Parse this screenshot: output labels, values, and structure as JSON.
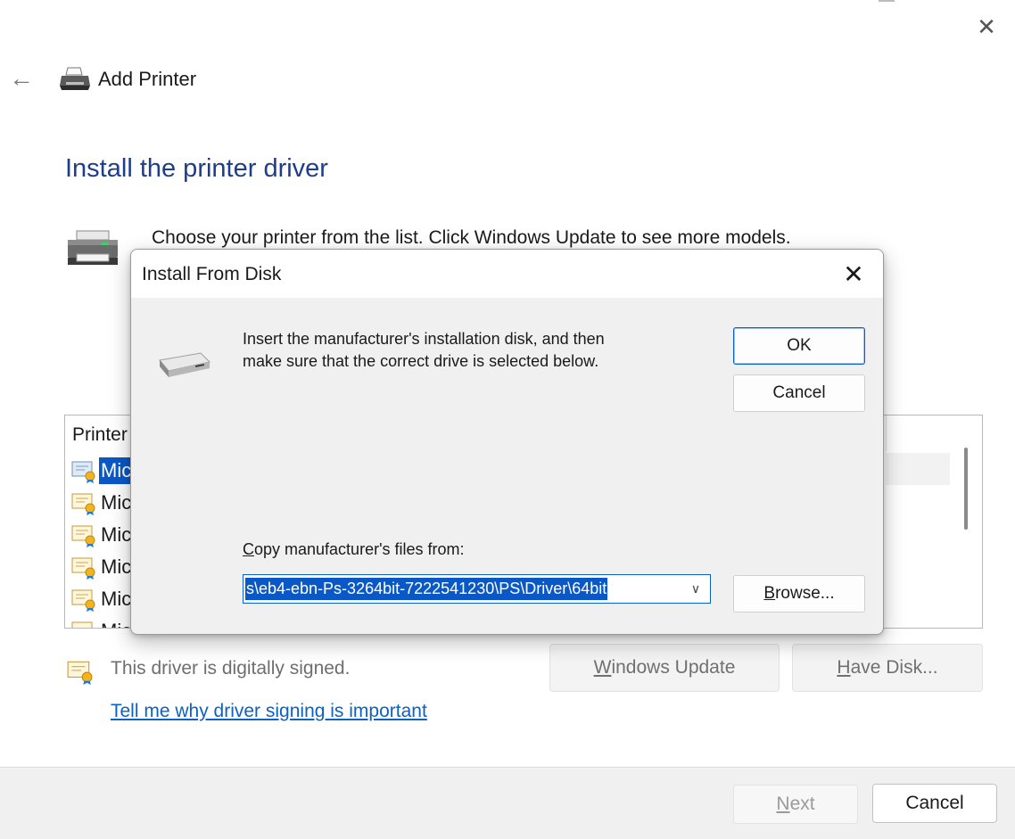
{
  "wizard": {
    "title": "Add Printer",
    "heading": "Install the printer driver",
    "instructions": "Choose your printer from the list. Click Windows Update to see more models.",
    "list_header": "Printer",
    "list_items": [
      {
        "label": "Mic",
        "selected": true
      },
      {
        "label": "Mic",
        "selected": false
      },
      {
        "label": "Mic",
        "selected": false
      },
      {
        "label": "Mic",
        "selected": false
      },
      {
        "label": "Mic",
        "selected": false
      },
      {
        "label": "Mic",
        "selected": false
      }
    ],
    "signed_text": "This driver is digitally signed.",
    "signing_link": "Tell me why driver signing is important",
    "windows_update": {
      "pre": "",
      "accel": "W",
      "post": "indows Update"
    },
    "have_disk": {
      "pre": "",
      "accel": "H",
      "post": "ave Disk..."
    },
    "next": {
      "pre": "",
      "accel": "N",
      "post": "ext"
    },
    "cancel": "Cancel"
  },
  "dialog": {
    "title": "Install From Disk",
    "message_line1": "Insert the manufacturer's installation disk, and then",
    "message_line2": "make sure that the correct drive is selected below.",
    "ok": "OK",
    "cancel": "Cancel",
    "copy_label": {
      "pre": "",
      "accel": "C",
      "post": "opy manufacturer's files from:"
    },
    "copy_value": "s\\eb4-ebn-Ps-3264bit-7222541230\\PS\\Driver\\64bit",
    "browse": {
      "pre": "",
      "accel": "B",
      "post": "rowse..."
    }
  },
  "icons": {
    "close": "close-icon",
    "back": "back-arrow-icon",
    "printer": "printer-icon",
    "disk": "disk-drive-icon",
    "certificate": "certificate-icon",
    "chevron": "chevron-down-icon"
  },
  "colors": {
    "heading": "#1d3e8c",
    "selection": "#0a58c6",
    "link": "#0b62c4",
    "footer_bg": "#f0f0f0"
  }
}
